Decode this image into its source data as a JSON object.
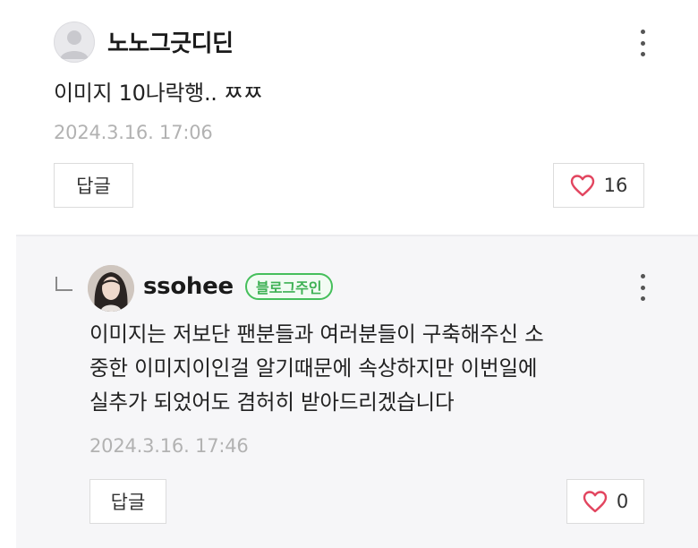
{
  "top_comment": {
    "username": "노노그긋디딘",
    "text": "이미지 10나락행.. ㅉㅉ",
    "date": "2024.3.16. 17:06",
    "reply_label": "답글",
    "like_count": "16"
  },
  "reply_comment": {
    "username": "ssohee",
    "badge": "블로그주인",
    "lines": [
      "이미지는 저보단 팬분들과 여러분들이 구축해주신 소",
      "중한 이미지이인걸 알기때문에 속상하지만 이번일에",
      "실추가 되었어도 겸허히 받아드리겠습니다"
    ],
    "date": "2024.3.16. 17:46",
    "reply_label": "답글",
    "like_count": "0"
  },
  "icons": {
    "more": "more-vertical-icon",
    "heart": "heart-outline-icon",
    "reply_arrow": "reply-corner-icon",
    "default_avatar": "default-user-avatar"
  },
  "colors": {
    "heart": "#e2455f",
    "badge_green": "#45bf5b",
    "date_gray": "#b2b2b2",
    "reply_bg": "#f6f6f8"
  }
}
